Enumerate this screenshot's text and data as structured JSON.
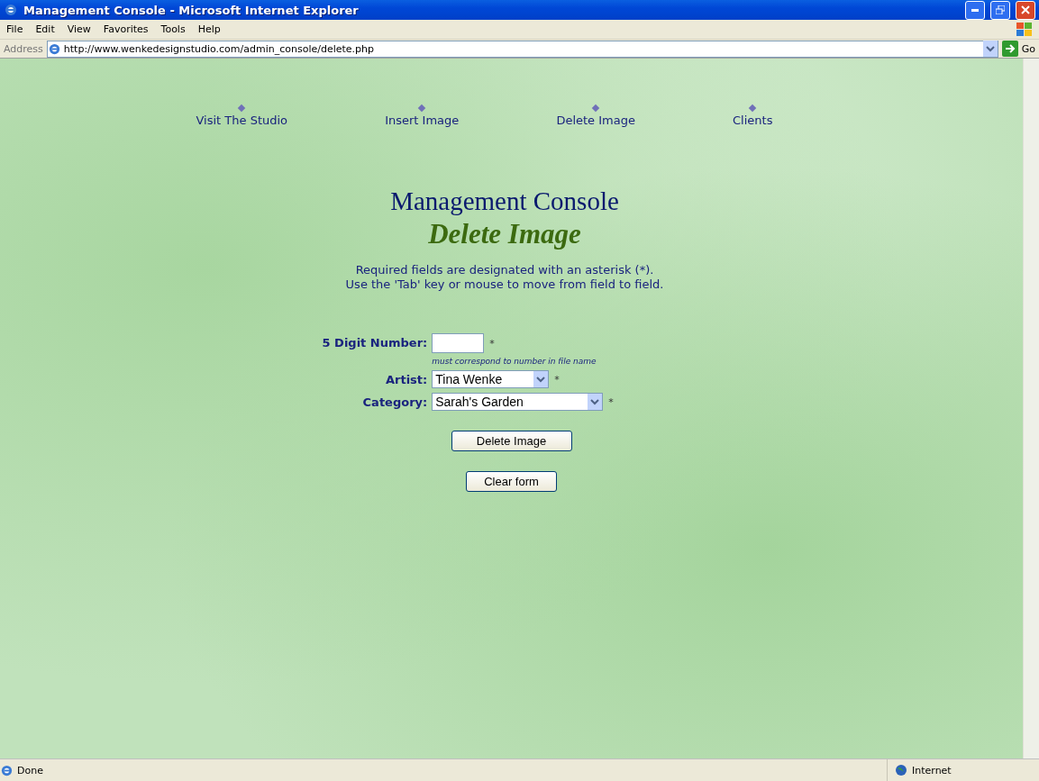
{
  "window": {
    "title": "Management Console - Microsoft Internet Explorer"
  },
  "menu": [
    "File",
    "Edit",
    "View",
    "Favorites",
    "Tools",
    "Help"
  ],
  "address": {
    "label": "Address",
    "value": "http://www.wenkedesignstudio.com/admin_console/delete.php",
    "go": "Go"
  },
  "nav": [
    "Visit The Studio",
    "Insert Image",
    "Delete Image",
    "Clients"
  ],
  "heading": "Management Console",
  "subheading": "Delete Image",
  "instructions": [
    "Required fields are designated with an asterisk (*).",
    "Use the 'Tab' key or mouse to move from field to field."
  ],
  "fields": [
    {
      "kind": "text",
      "label": "5 Digit Number:",
      "required": "*",
      "hint": "must correspond to number in file name"
    },
    {
      "kind": "select",
      "label": "Artist:",
      "value": "Tina Wenke",
      "required": "*"
    },
    {
      "kind": "select",
      "label": "Category:",
      "value": "Sarah's Garden",
      "required": "*"
    }
  ],
  "buttons": [
    "Delete Image",
    "Clear form"
  ],
  "status_bar": {
    "text": "Done",
    "zone": "Internet"
  }
}
